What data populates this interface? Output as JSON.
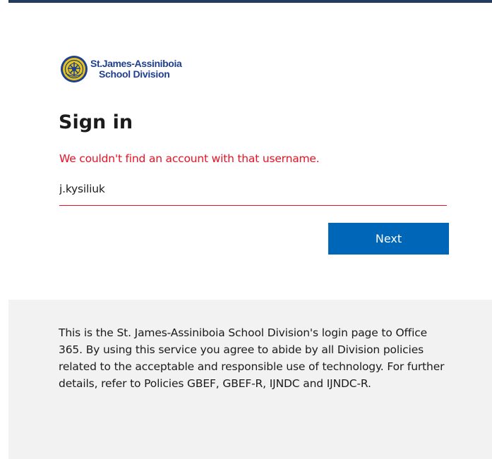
{
  "org": {
    "name_line1": "St.James-Assiniboia",
    "name_line2": "School Division"
  },
  "signin": {
    "title": "Sign in",
    "error_message": "We couldn't find an account with that username.",
    "username_value": "j.kysiliuk",
    "next_label": "Next"
  },
  "footer": {
    "notice": "This is the St. James-Assiniboia School Division's login page to Office 365. By using this service you agree to abide by all Division policies related to the acceptable and responsible use of technology. For further details, refer to Policies GBEF, GBEF-R, IJNDC and IJNDC-R."
  },
  "colors": {
    "accent": "#0067b8",
    "error": "#e81123",
    "header_bar": "#243a5e",
    "footer_bg": "#f2f2f2",
    "logo_blue": "#1f3f8f",
    "logo_gold": "#e6c419"
  },
  "icons": {
    "logo": "school-division-seal-icon"
  }
}
